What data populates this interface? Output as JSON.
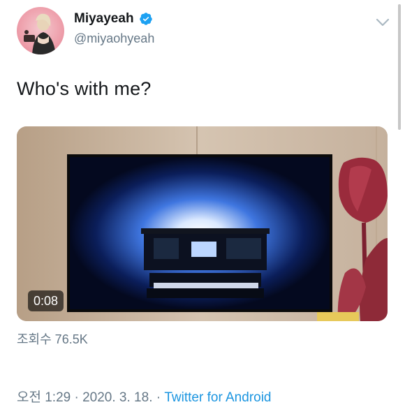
{
  "user": {
    "display_name": "Miyayeah",
    "handle": "@miyaohyeah",
    "verified": true,
    "avatar_icon": "avatar"
  },
  "tweet": {
    "text": "Who's with me?"
  },
  "media": {
    "duration": "0:08",
    "views": "조회수 76.5K"
  },
  "meta": {
    "time": "오전 1:29",
    "sep1": " · ",
    "date": "2020. 3. 18.",
    "sep2": " · ",
    "source": "Twitter for Android"
  },
  "colors": {
    "text": "#14171a",
    "secondary": "#657786",
    "link": "#1b95e0",
    "verified": "#1da1f2"
  },
  "icons": {
    "verified": "verified-badge-icon",
    "menu": "chevron-down-icon",
    "video": "video-thumbnail"
  }
}
